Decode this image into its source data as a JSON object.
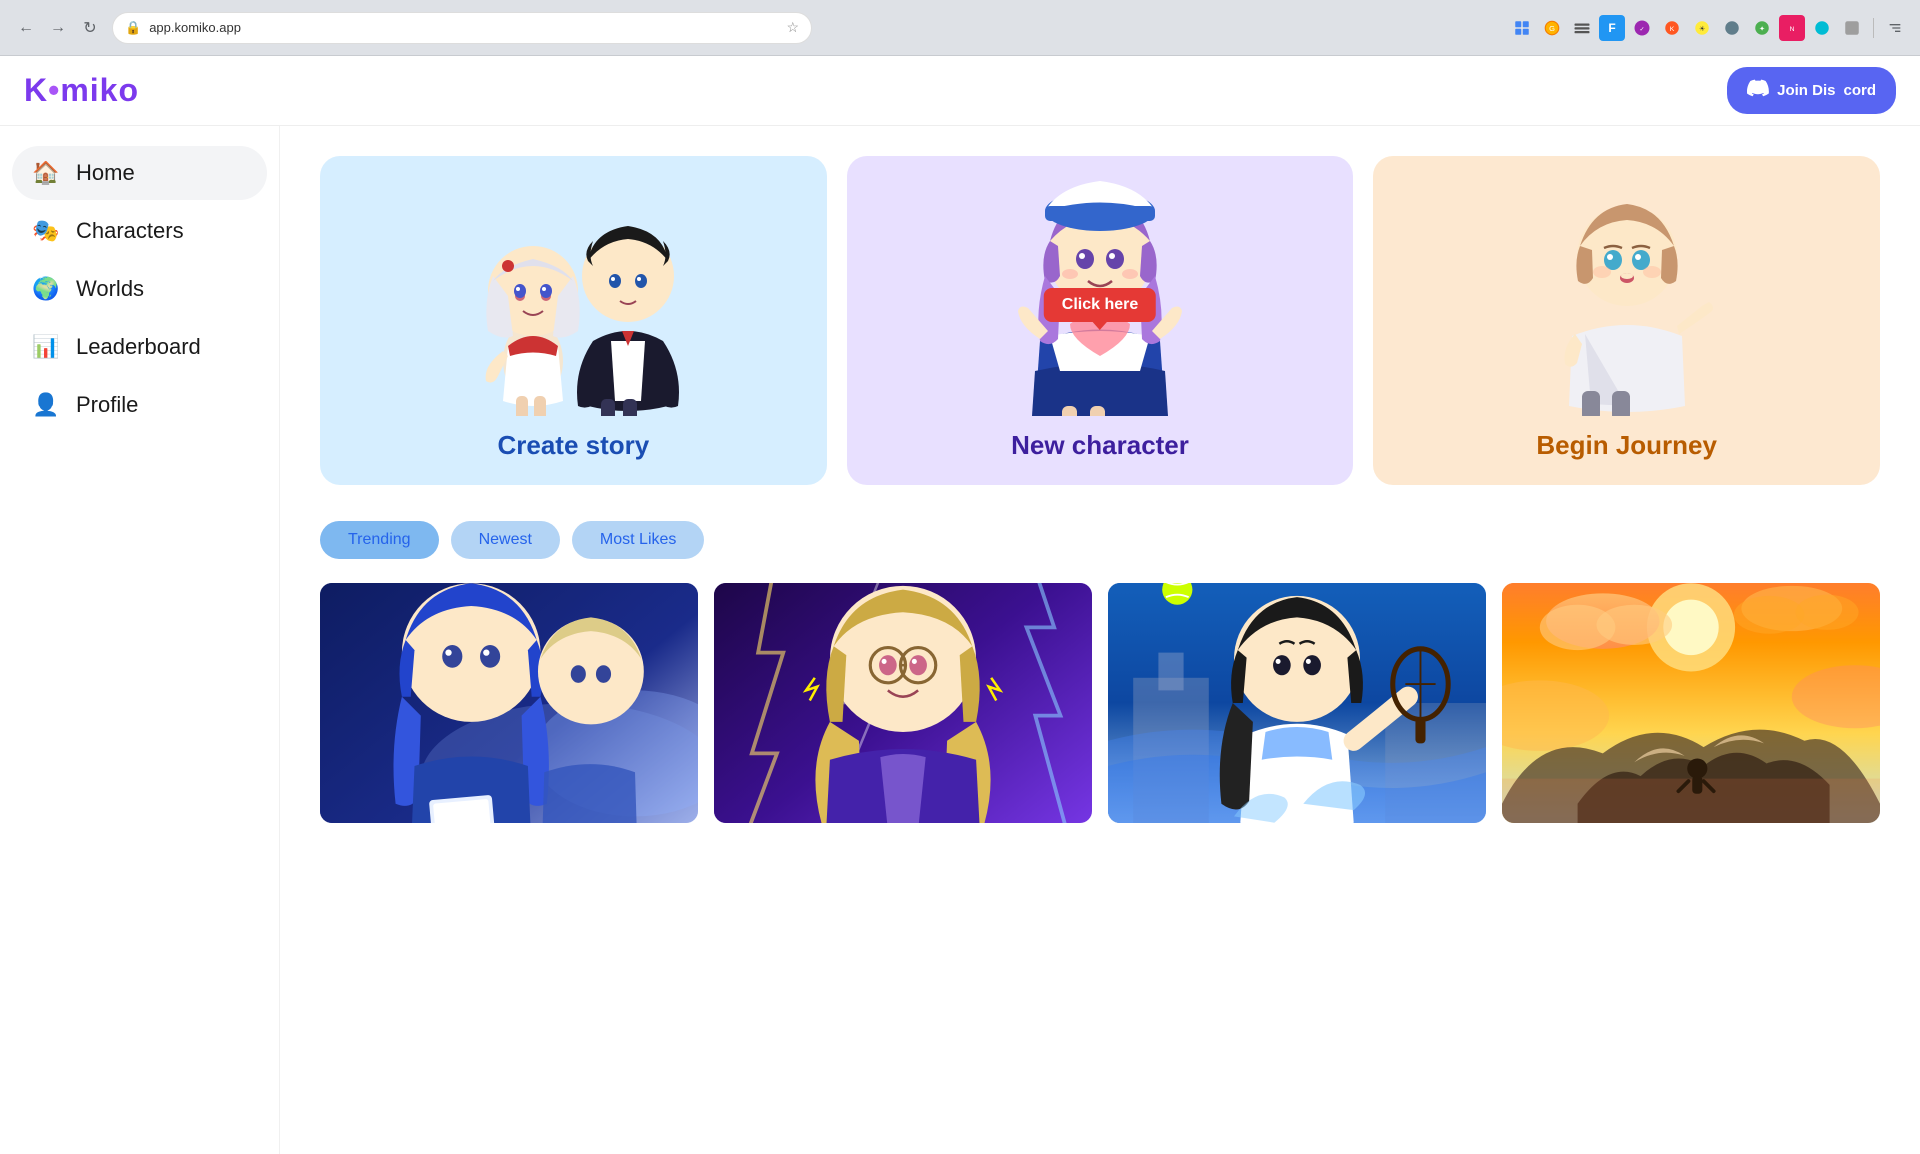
{
  "browser": {
    "url": "app.komiko.app",
    "back_title": "Back",
    "forward_title": "Forward",
    "reload_title": "Reload"
  },
  "header": {
    "logo_text": "K•miko",
    "logo_dot": "•",
    "discord_btn": "Join Dis"
  },
  "sidebar": {
    "items": [
      {
        "id": "home",
        "label": "Home",
        "icon": "🏠",
        "active": true
      },
      {
        "id": "characters",
        "label": "Characters",
        "icon": "🎭",
        "active": false
      },
      {
        "id": "worlds",
        "label": "Worlds",
        "icon": "🌍",
        "active": false
      },
      {
        "id": "leaderboard",
        "label": "Leaderboard",
        "icon": "📊",
        "active": false
      },
      {
        "id": "profile",
        "label": "Profile",
        "icon": "👤",
        "active": false
      }
    ]
  },
  "feature_cards": [
    {
      "id": "create-story",
      "title": "Create story",
      "title_color": "blue",
      "bg": "blue-bg"
    },
    {
      "id": "new-character",
      "title": "New character",
      "title_color": "purple",
      "bg": "purple-bg",
      "badge": "Click here"
    },
    {
      "id": "begin-journey",
      "title": "Begin Journey",
      "title_color": "orange",
      "bg": "peach-bg"
    }
  ],
  "filter_tabs": [
    {
      "id": "trending",
      "label": "Trending",
      "active": true
    },
    {
      "id": "newest",
      "label": "Newest",
      "active": false
    },
    {
      "id": "most-likes",
      "label": "Most Likes",
      "active": false
    }
  ],
  "image_cards": [
    {
      "id": "card-1",
      "bg_class": "anime-card-1"
    },
    {
      "id": "card-2",
      "bg_class": "anime-card-2"
    },
    {
      "id": "card-3",
      "bg_class": "anime-card-3"
    },
    {
      "id": "card-4",
      "bg_class": "anime-card-4"
    }
  ],
  "icons": {
    "back": "←",
    "forward": "→",
    "reload": "↻",
    "lock": "🔒",
    "star": "☆",
    "discord_icon": "🎮"
  }
}
